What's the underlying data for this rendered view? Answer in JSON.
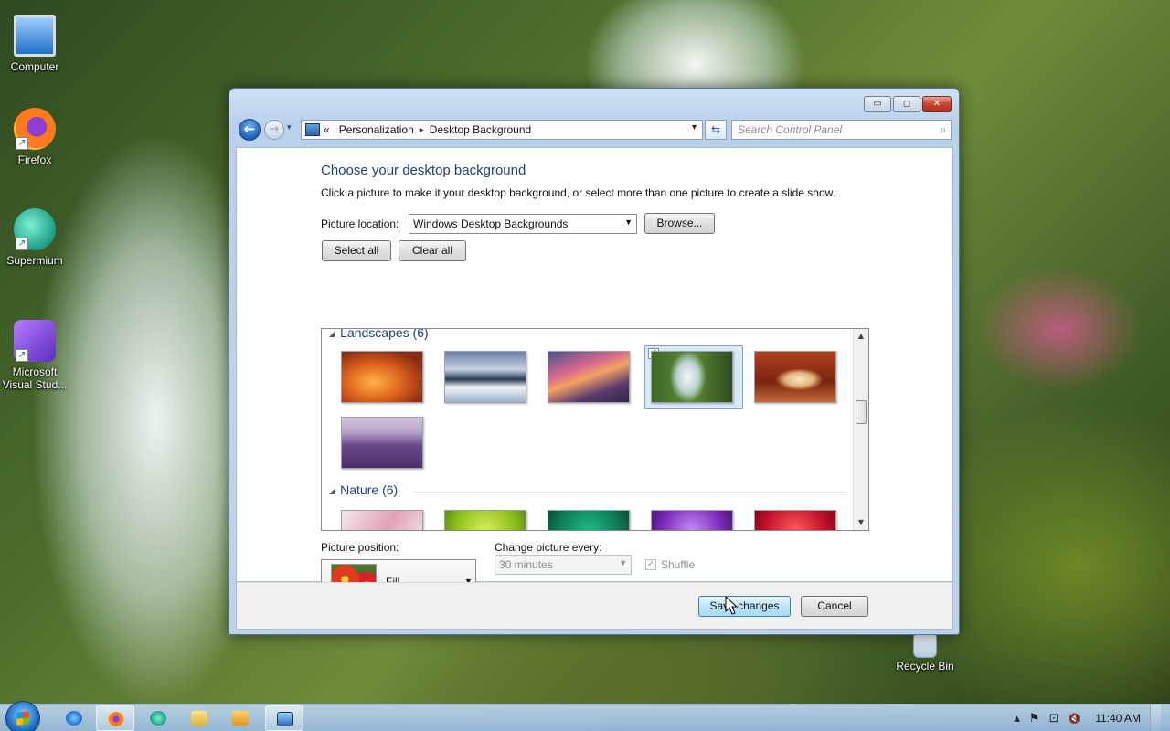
{
  "desktop": {
    "icons": [
      {
        "label": "Computer",
        "icon": "computer-icon"
      },
      {
        "label": "Firefox",
        "icon": "firefox-icon"
      },
      {
        "label": "Supermium",
        "icon": "supermium-icon"
      },
      {
        "label": "Microsoft Visual Stud...",
        "icon": "visual-studio-icon"
      },
      {
        "label": "Recycle Bin",
        "icon": "recycle-bin-icon"
      }
    ]
  },
  "window": {
    "caption": {
      "minimize": "▭",
      "maximize": "◻",
      "close": "✕"
    },
    "nav": {
      "back": "←",
      "forward": "→",
      "dropdown": "▾"
    },
    "address": {
      "root_marker": "«",
      "crumbs": [
        "Personalization",
        "Desktop Background"
      ],
      "separator": "▸",
      "dropdown": "▾"
    },
    "refresh": "⇆",
    "search": {
      "placeholder": "Search Control Panel",
      "icon": "search-icon"
    },
    "heading": "Choose your desktop background",
    "description": "Click a picture to make it your desktop background, or select more than one picture to create a slide show.",
    "picture_location": {
      "label": "Picture location:",
      "value": "Windows Desktop Backgrounds",
      "browse": "Browse..."
    },
    "select_all": "Select all",
    "clear_all": "Clear all",
    "gallery": {
      "groups": [
        {
          "name": "Landscapes (6)",
          "thumbnails": [
            "canyon-rock",
            "ice-lake",
            "sunset-coast",
            "waterfall",
            "rock-arch",
            "lavender-field"
          ],
          "selected": "waterfall"
        },
        {
          "name": "Nature (6)",
          "thumbnails": [
            "pink-flower",
            "green-leaf",
            "green-plant",
            "purple-flower",
            "red-flower"
          ]
        }
      ],
      "checkmark": "✓"
    },
    "picture_position": {
      "label": "Picture position:",
      "value": "Fill"
    },
    "change_every": {
      "label": "Change picture every:",
      "value": "30 minutes",
      "enabled": false
    },
    "shuffle": {
      "label": "Shuffle",
      "checked": true,
      "enabled": false
    },
    "save": "Save changes",
    "cancel": "Cancel"
  },
  "taskbar": {
    "pinned": [
      "internet-explorer-icon",
      "firefox-icon",
      "supermium-icon",
      "file-explorer-icon",
      "media-player-icon",
      "control-panel-icon"
    ],
    "active": "control-panel-icon",
    "tray": {
      "chevron": "▴",
      "flag": "⚑",
      "network": "⊡",
      "volume": "🔇",
      "time": "11:40 AM"
    }
  },
  "colors": {
    "heading": "#1e3f8a",
    "primary_button": "#bee6fd",
    "taskbar": "#aac8e8"
  }
}
